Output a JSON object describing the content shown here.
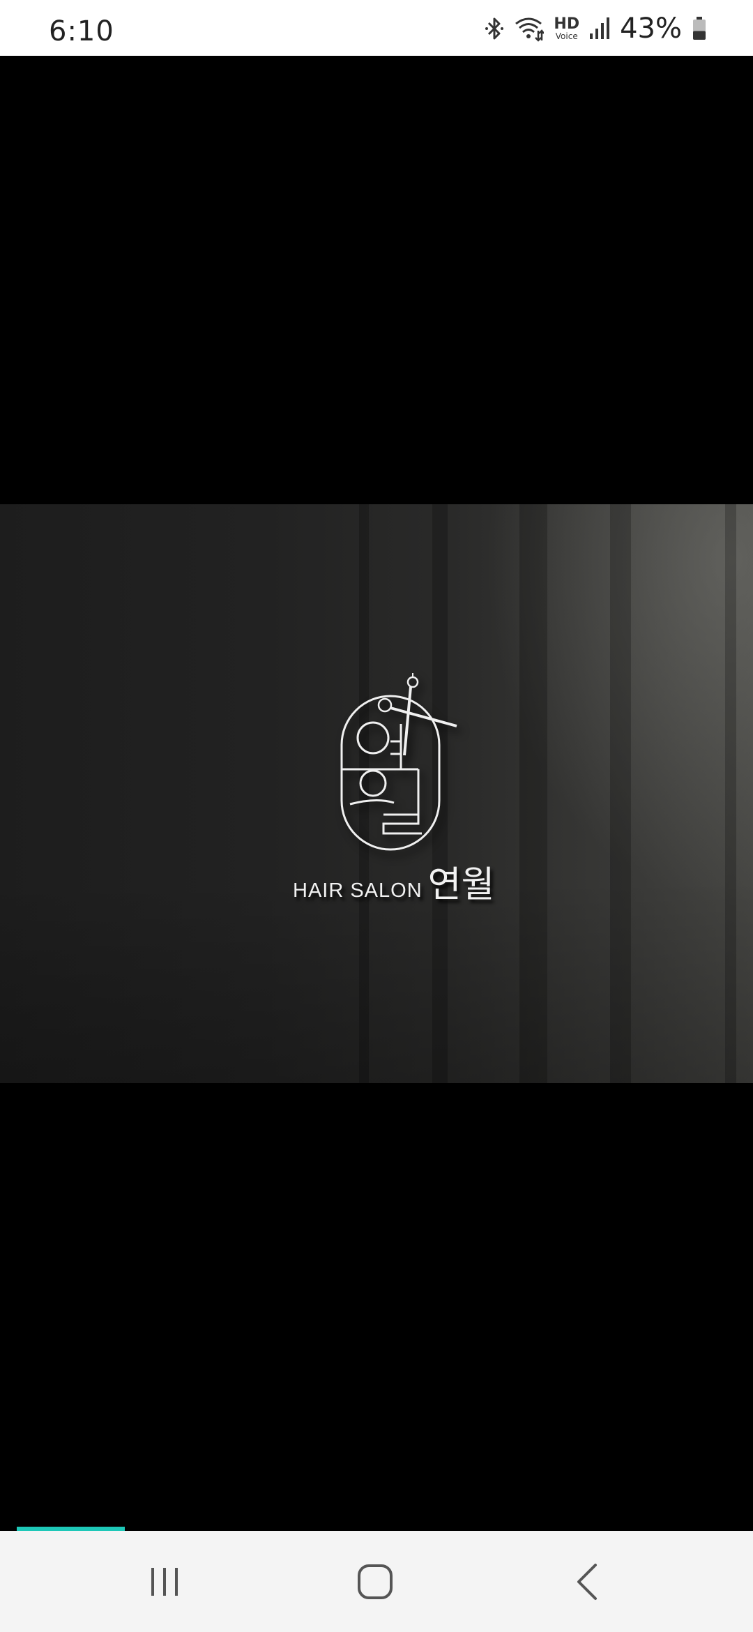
{
  "status_bar": {
    "time": "6:10",
    "hd_label": "HD",
    "voice_label": "Voice",
    "battery_percent": "43%",
    "battery_level": 0.43,
    "icons": [
      "bluetooth-icon",
      "wifi-icon",
      "hd-voice-icon",
      "signal-icon",
      "battery-icon"
    ]
  },
  "splash": {
    "logo_text_en": "HAIR SALON",
    "logo_text_ko": "연월",
    "logo_icon": "scissors-icon"
  },
  "loading": {
    "progress": 0.15,
    "color": "#1ec8b8"
  },
  "nav_bar": {
    "buttons": [
      "recent-apps-icon",
      "home-icon",
      "back-icon"
    ]
  },
  "colors": {
    "status_bar_bg": "#ffffff",
    "background": "#000000",
    "nav_bar_bg": "#f4f4f4"
  }
}
